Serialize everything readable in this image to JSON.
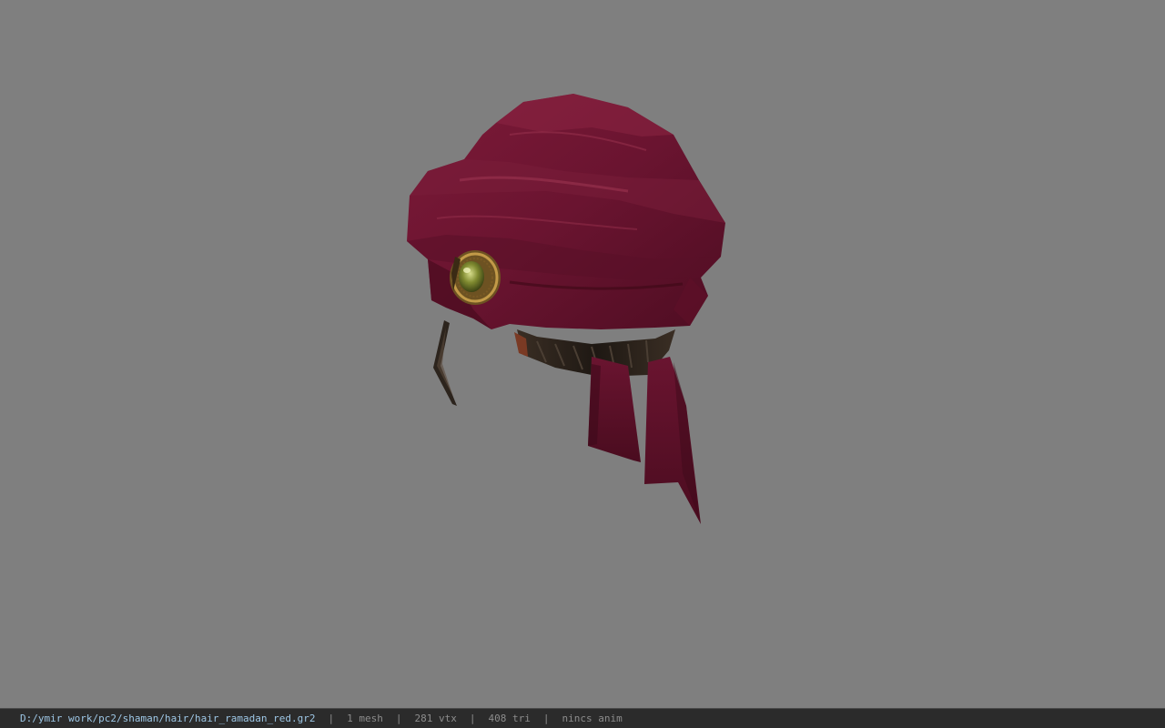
{
  "viewer": {
    "background_color": "#7f7f7f",
    "model_icon": "turban-hat-model"
  },
  "statusbar": {
    "file_path": "D:/ymir work/pc2/shaman/hair/hair_ramadan_red.gr2",
    "separator": "|",
    "mesh_count": "1 mesh",
    "vertex_count": "281 vtx",
    "triangle_count": "408 tri",
    "anim_status": "nincs anim"
  },
  "colors": {
    "turban_main": "#6e1530",
    "turban_dark": "#4a0c1f",
    "turban_light": "#8a2540",
    "hair_dark": "#2a221c",
    "jewel_gold": "#b08a3a",
    "jewel_green": "#8a9a3a",
    "path_text": "#9ec7e6"
  }
}
